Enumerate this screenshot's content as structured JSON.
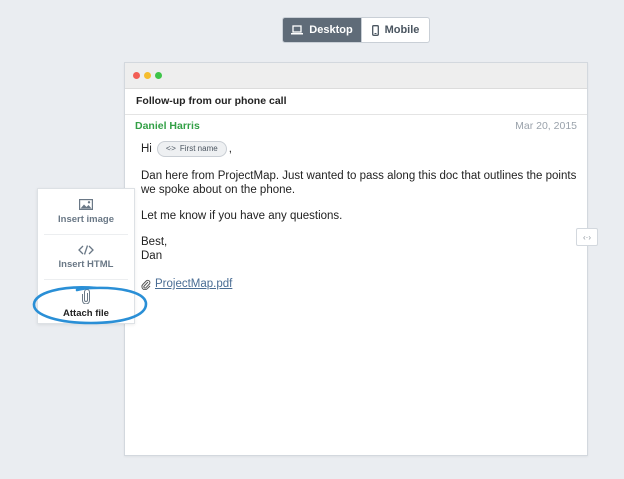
{
  "toggle": {
    "desktop_label": "Desktop",
    "mobile_label": "Mobile",
    "selected": "Desktop"
  },
  "email": {
    "subject": "Follow-up from our phone call",
    "sender": "Daniel Harris",
    "date": "Mar 20, 2015",
    "greeting": "Hi",
    "merge_tag": "First name",
    "greeting_suffix": ",",
    "paragraph1": "Dan here from ProjectMap. Just wanted to pass along this doc that outlines the points we spoke about on the phone.",
    "paragraph2": "Let me know if you have any questions.",
    "signoff_line1": "Best,",
    "signoff_line2": "Dan",
    "attachment": "ProjectMap.pdf"
  },
  "insert_menu": {
    "items": [
      {
        "label": "Insert image",
        "icon": "image-icon"
      },
      {
        "label": "Insert HTML",
        "icon": "code-icon"
      },
      {
        "label": "Attach file",
        "icon": "paperclip-icon"
      }
    ]
  },
  "colors": {
    "background": "#eaedf1",
    "toggle_active": "#5f6b78",
    "sender": "#33a046",
    "link": "#4a6d94",
    "highlight_circle": "#2a8fd6"
  }
}
